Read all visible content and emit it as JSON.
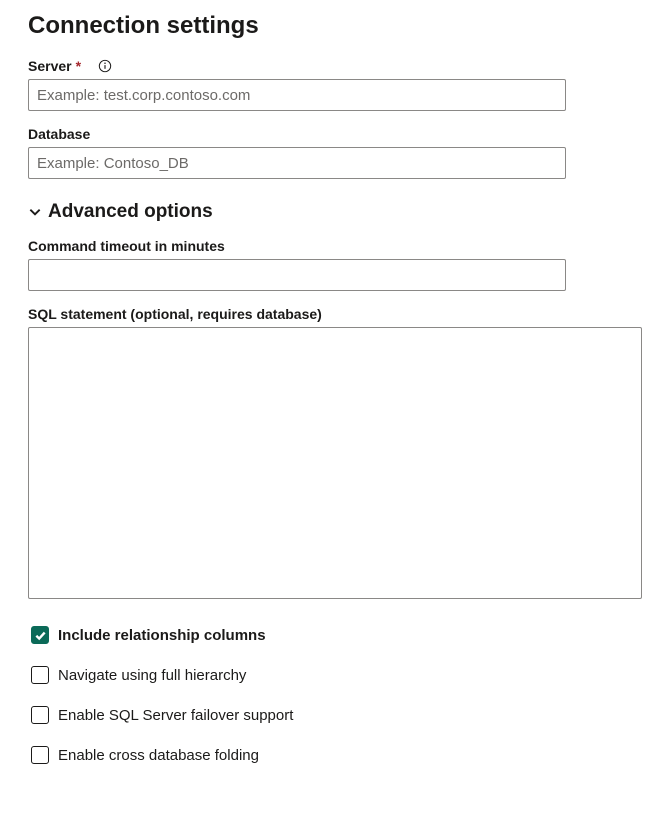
{
  "title": "Connection settings",
  "fields": {
    "server": {
      "label": "Server",
      "required": true,
      "placeholder": "Example: test.corp.contoso.com",
      "value": ""
    },
    "database": {
      "label": "Database",
      "required": false,
      "placeholder": "Example: Contoso_DB",
      "value": ""
    }
  },
  "advanced": {
    "header": "Advanced options",
    "expanded": true,
    "timeout": {
      "label": "Command timeout in minutes",
      "value": ""
    },
    "sql": {
      "label": "SQL statement (optional, requires database)",
      "value": ""
    },
    "checks": [
      {
        "label": "Include relationship columns",
        "checked": true
      },
      {
        "label": "Navigate using full hierarchy",
        "checked": false
      },
      {
        "label": "Enable SQL Server failover support",
        "checked": false
      },
      {
        "label": "Enable cross database folding",
        "checked": false
      }
    ]
  }
}
